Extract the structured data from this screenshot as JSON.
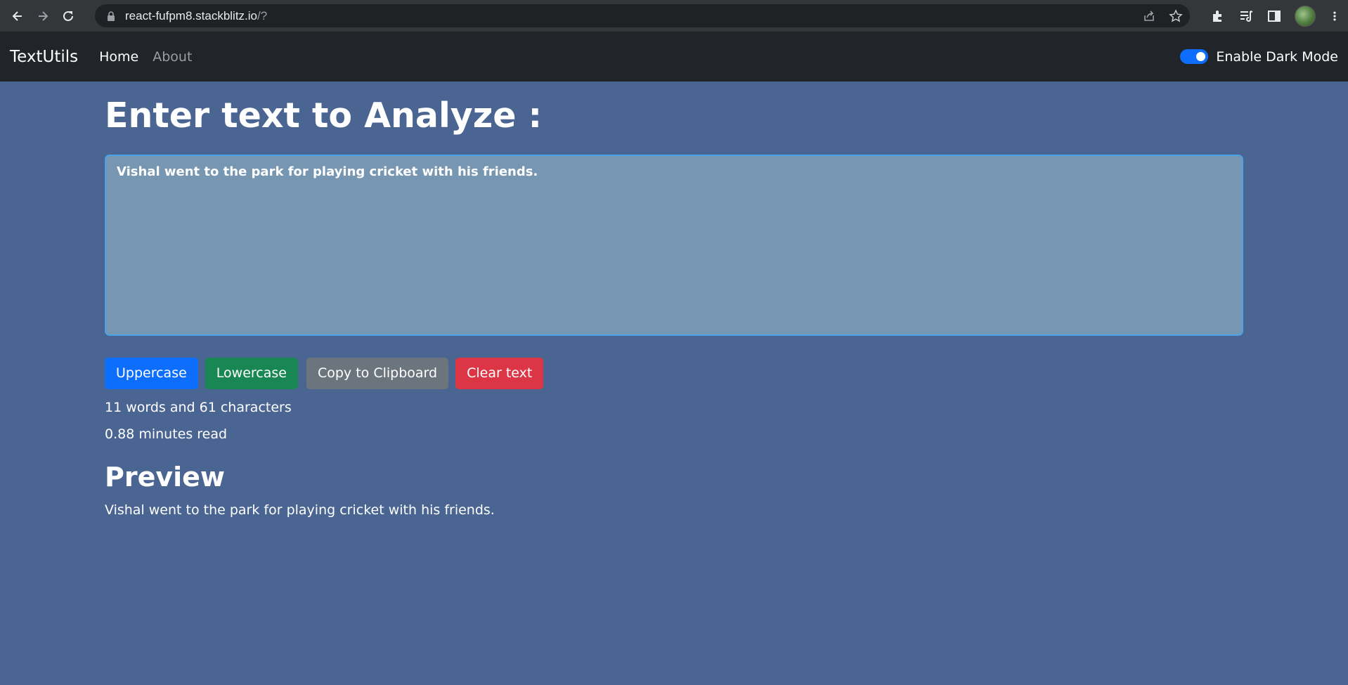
{
  "browser": {
    "url_host": "react-fufpm8.stackblitz.io",
    "url_path": "/?"
  },
  "navbar": {
    "brand": "TextUtils",
    "links": [
      {
        "label": "Home",
        "active": true
      },
      {
        "label": "About",
        "active": false
      }
    ],
    "dark_mode_label": "Enable Dark Mode",
    "dark_mode_enabled": true
  },
  "main": {
    "heading": "Enter text to Analyze :",
    "textarea_value": "Vishal went to the park for playing cricket with his friends.",
    "buttons": {
      "uppercase": "Uppercase",
      "lowercase": "Lowercase",
      "copy": "Copy to Clipboard",
      "clear": "Clear text"
    },
    "stats": {
      "summary": "11 words and 61 characters",
      "read_time": "0.88 minutes read"
    },
    "preview_heading": "Preview",
    "preview_text": "Vishal went to the park for playing cricket with his friends."
  },
  "colors": {
    "page_bg": "#4a6592",
    "navbar_bg": "#212529",
    "textarea_bg": "#7696b1",
    "primary": "#0d6efd",
    "success": "#198754",
    "secondary": "#6c757d",
    "danger": "#dc3545"
  },
  "icons": {
    "back": "arrow-left-icon",
    "forward": "arrow-right-icon",
    "reload": "reload-icon",
    "lock": "lock-icon",
    "share": "share-icon",
    "bookmark": "star-icon",
    "extensions": "puzzle-icon",
    "media": "media-queue-icon",
    "side_panel": "side-panel-icon",
    "menu": "kebab-menu-icon"
  }
}
